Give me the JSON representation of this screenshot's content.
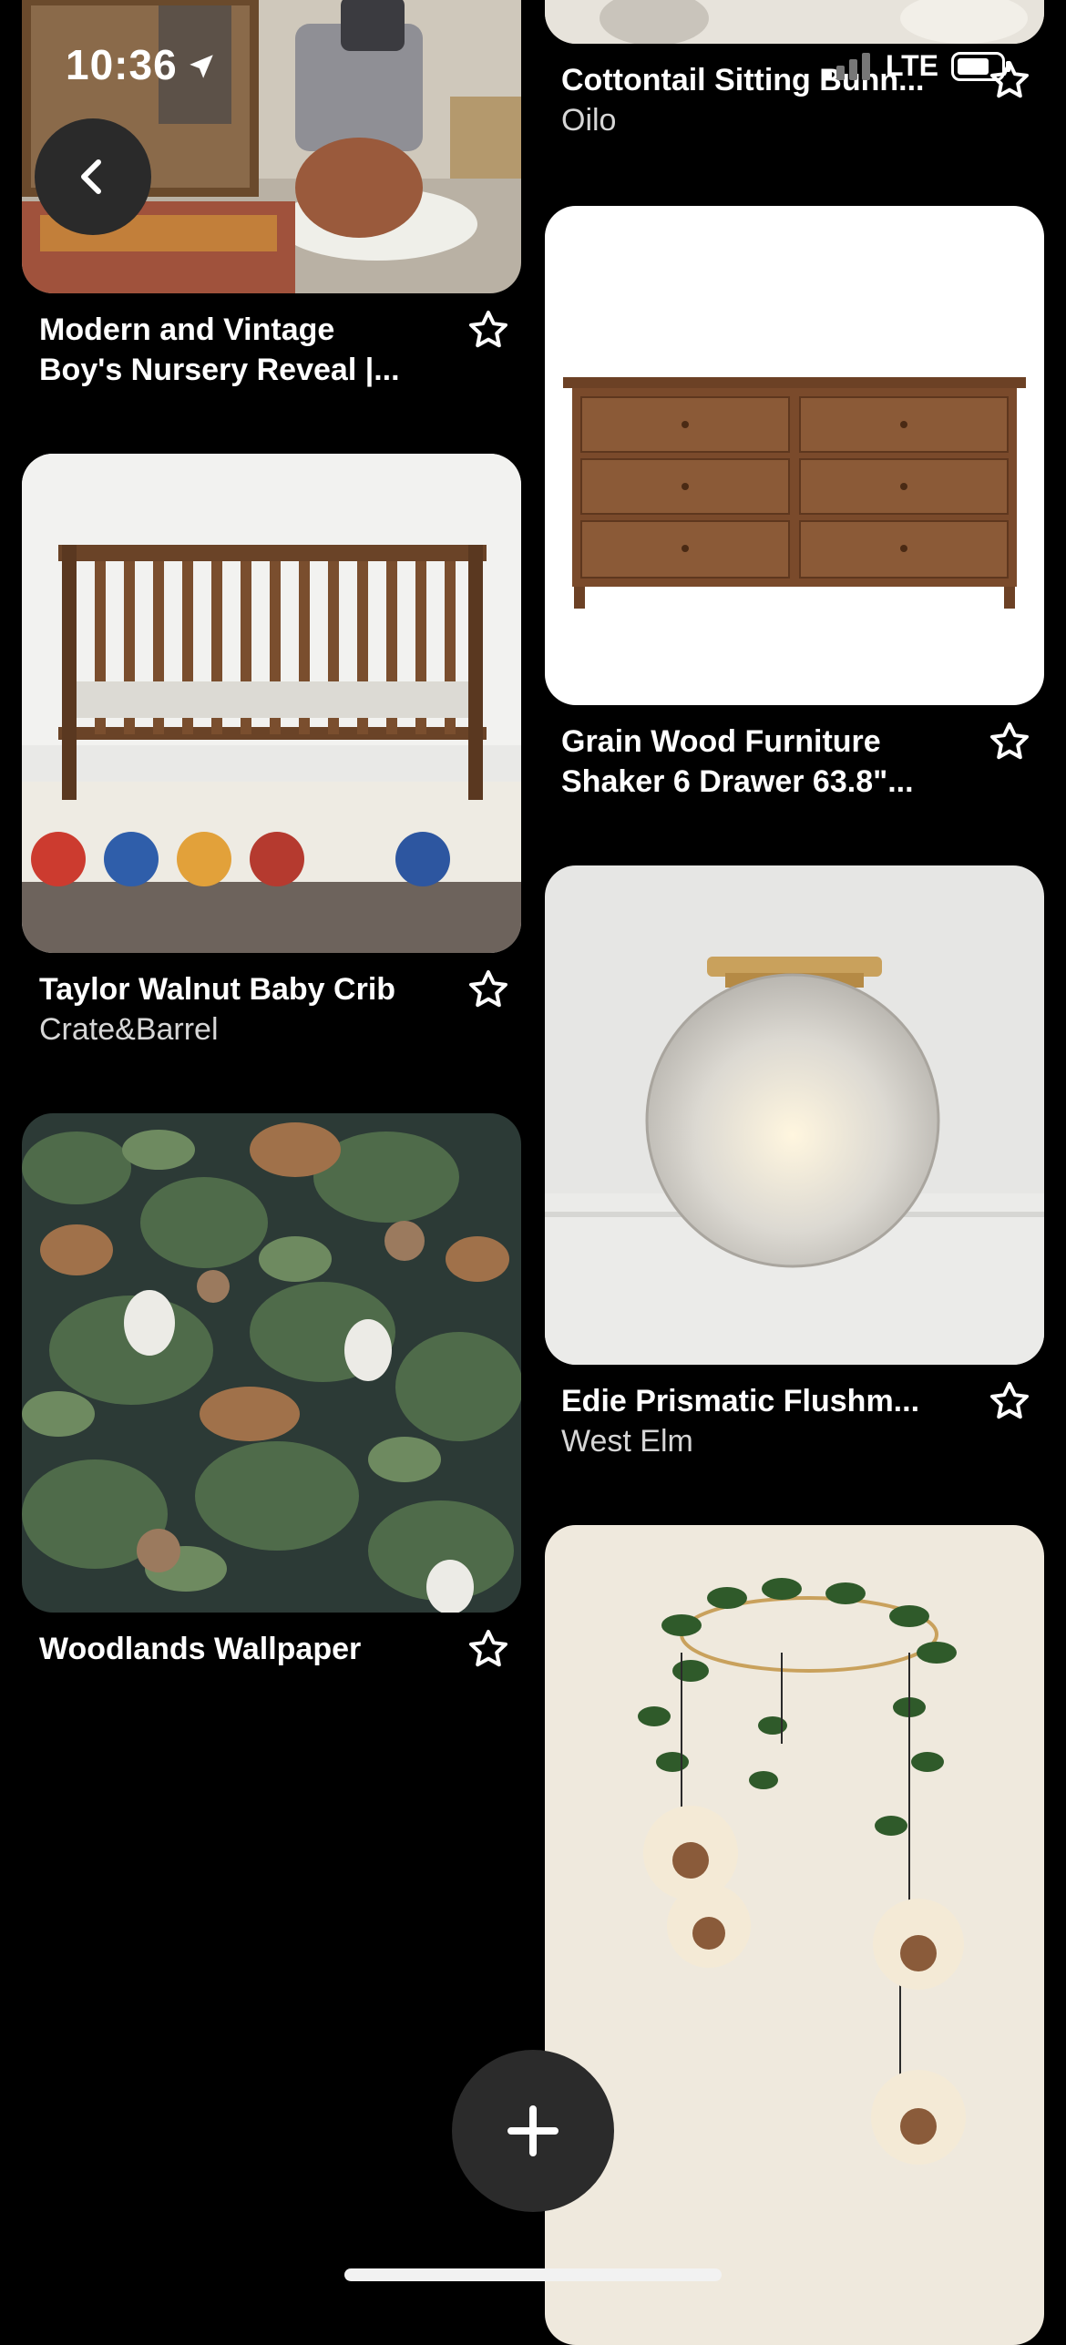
{
  "status_bar": {
    "time": "10:36",
    "network": "LTE"
  },
  "left_column": [
    {
      "title_line1": "Modern and Vintage",
      "title_line2": "Boy's Nursery Reveal |..."
    },
    {
      "title": "Taylor Walnut Baby Crib",
      "subtitle": "Crate&Barrel"
    },
    {
      "title": "Woodlands Wallpaper"
    }
  ],
  "right_column": [
    {
      "title": "Cottontail Sitting Bunn...",
      "subtitle": "Oilo"
    },
    {
      "title_line1": "Grain Wood Furniture",
      "title_line2": "Shaker 6 Drawer 63.8\"..."
    },
    {
      "title": "Edie Prismatic Flushm...",
      "subtitle": "West Elm"
    }
  ],
  "icons": {
    "back": "chevron-left-icon",
    "favorite": "star-outline-icon",
    "add": "plus-icon"
  },
  "colors": {
    "background": "#000000",
    "button": "#2a2a2a"
  }
}
